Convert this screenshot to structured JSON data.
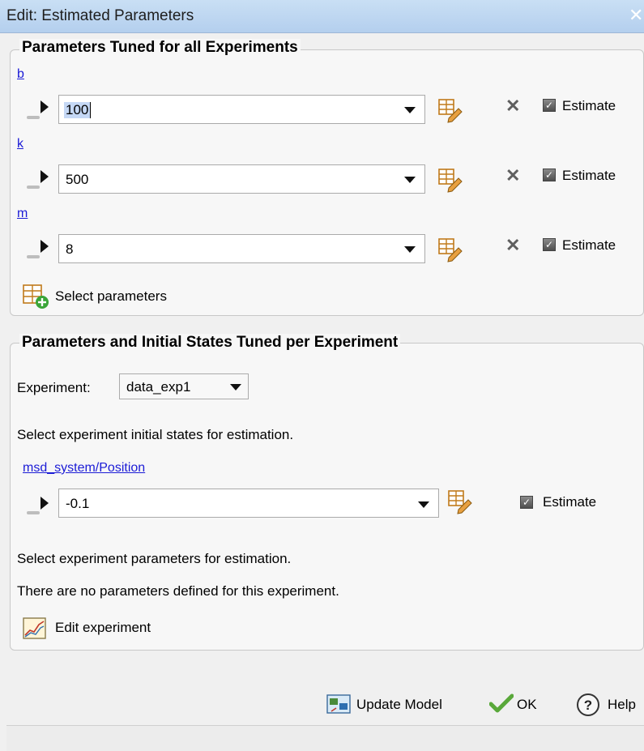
{
  "window": {
    "title": "Edit: Estimated Parameters",
    "close_glyph": "✕"
  },
  "section1": {
    "title": "Parameters Tuned for all Experiments",
    "params": [
      {
        "name": "b",
        "value": "100",
        "estimate_label": "Estimate"
      },
      {
        "name": "k",
        "value": "500",
        "estimate_label": "Estimate"
      },
      {
        "name": "m",
        "value": "8",
        "estimate_label": "Estimate"
      }
    ],
    "select_label": "Select parameters"
  },
  "section2": {
    "title": "Parameters and Initial States Tuned per Experiment",
    "experiment_label": "Experiment:",
    "experiment_value": "data_exp1",
    "states_prompt": "Select experiment initial states for estimation.",
    "state": {
      "name": "msd_system/Position",
      "value": "-0.1",
      "estimate_label": "Estimate"
    },
    "params_prompt": "Select experiment parameters for estimation.",
    "no_params": "There are no parameters defined for this experiment.",
    "edit_label": "Edit experiment"
  },
  "footer": {
    "update_label": "Update Model",
    "ok_label": "OK",
    "help_label": "Help"
  },
  "icons": {
    "expand": "triangle-right-icon",
    "edit": "table-edit-icon",
    "remove": "close-icon",
    "add": "table-add-icon",
    "experiment": "experiment-chart-icon",
    "update": "update-model-icon",
    "ok": "checkmark-icon",
    "help": "question-mark-icon"
  }
}
